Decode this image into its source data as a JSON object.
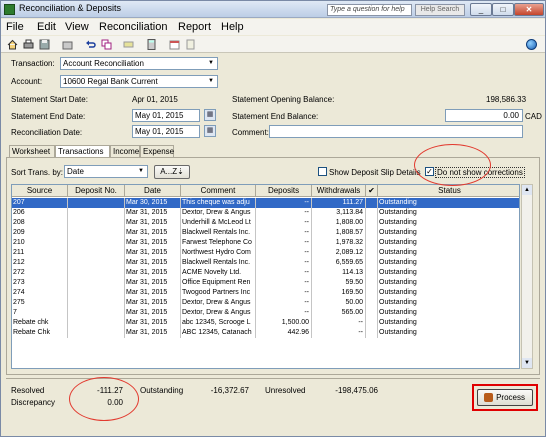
{
  "window": {
    "title": "Reconciliation & Deposits",
    "help_placeholder": "Type a question for help",
    "help_search": "Help Search",
    "min": "_",
    "max": "□",
    "close": "✕"
  },
  "menu": [
    "File",
    "Edit",
    "View",
    "Reconciliation",
    "Report",
    "Help"
  ],
  "toolbar_icons": [
    "home-icon",
    "print-icon",
    "save-icon",
    "open-icon",
    "undo-icon",
    "copy-icon",
    "highlight-icon",
    "calculator-icon",
    "calendar-icon",
    "notes-icon"
  ],
  "form": {
    "transaction_label": "Transaction:",
    "transaction_value": "Account Reconciliation",
    "account_label": "Account:",
    "account_value": "10600 Regal Bank Current",
    "start_date_label": "Statement Start Date:",
    "start_date_value": "Apr 01, 2015",
    "end_date_label": "Statement End Date:",
    "end_date_value": "May 01, 2015",
    "recon_date_label": "Reconciliation Date:",
    "recon_date_value": "May 01, 2015",
    "opening_balance_label": "Statement Opening Balance:",
    "opening_balance_value": "198,586.33",
    "end_balance_label": "Statement End Balance:",
    "end_balance_value": "0.00",
    "currency": "CAD",
    "comment_label": "Comment:",
    "comment_value": ""
  },
  "tabs": [
    "Worksheet",
    "Transactions",
    "Income",
    "Expense"
  ],
  "active_tab": 1,
  "sort": {
    "label": "Sort Trans. by:",
    "value": "Date",
    "az_button": "A...Z",
    "show_deposit_slip_label": "Show Deposit Slip Details",
    "show_deposit_slip_checked": false,
    "no_corrections_label": "Do not show corrections",
    "no_corrections_checked": true
  },
  "table": {
    "columns": [
      "Source",
      "Deposit No.",
      "Date",
      "Comment",
      "Deposits",
      "Withdrawals",
      "✔",
      "Status"
    ],
    "rows": [
      [
        "207",
        "",
        "Mar 30, 2015",
        "This cheque was adju",
        "--",
        "111.27",
        "",
        "Outstanding"
      ],
      [
        "206",
        "",
        "Mar 31, 2015",
        "Dextor, Drew & Angus",
        "--",
        "3,113.84",
        "",
        "Outstanding"
      ],
      [
        "208",
        "",
        "Mar 31, 2015",
        "Underhill & McLeod Lt",
        "--",
        "1,808.00",
        "",
        "Outstanding"
      ],
      [
        "209",
        "",
        "Mar 31, 2015",
        "Blackwell Rentals Inc.",
        "--",
        "1,808.57",
        "",
        "Outstanding"
      ],
      [
        "210",
        "",
        "Mar 31, 2015",
        "Farwest Telephone Co",
        "--",
        "1,978.32",
        "",
        "Outstanding"
      ],
      [
        "211",
        "",
        "Mar 31, 2015",
        "Northwest Hydro Com",
        "--",
        "2,089.12",
        "",
        "Outstanding"
      ],
      [
        "212",
        "",
        "Mar 31, 2015",
        "Blackwell Rentals Inc.",
        "--",
        "6,559.65",
        "",
        "Outstanding"
      ],
      [
        "272",
        "",
        "Mar 31, 2015",
        "ACME Novelty Ltd.",
        "--",
        "114.13",
        "",
        "Outstanding"
      ],
      [
        "273",
        "",
        "Mar 31, 2015",
        "Office Equipment Ren",
        "--",
        "59.50",
        "",
        "Outstanding"
      ],
      [
        "274",
        "",
        "Mar 31, 2015",
        "Twogood Partners Inc",
        "--",
        "169.50",
        "",
        "Outstanding"
      ],
      [
        "275",
        "",
        "Mar 31, 2015",
        "Dextor, Drew & Angus",
        "--",
        "50.00",
        "",
        "Outstanding"
      ],
      [
        "7",
        "",
        "Mar 31, 2015",
        "Dextor, Drew & Angus",
        "--",
        "565.00",
        "",
        "Outstanding"
      ],
      [
        "Rebate chk",
        "",
        "Mar 31, 2015",
        "abc 12345, Scrooge L",
        "1,500.00",
        "--",
        "",
        "Outstanding"
      ],
      [
        "Rebate Chk",
        "",
        "Mar 31, 2015",
        "ABC 12345, Catanach",
        "442.96",
        "--",
        "",
        "Outstanding"
      ]
    ],
    "selected_row": 0
  },
  "footer": {
    "resolved_label": "Resolved",
    "resolved_value": "-111.27",
    "discrepancy_label": "Discrepancy",
    "discrepancy_value": "0.00",
    "outstanding_label": "Outstanding",
    "outstanding_value": "-16,372.67",
    "unresolved_label": "Unresolved",
    "unresolved_value": "-198,475.06",
    "process_button": "Process"
  },
  "colors": {
    "selection": "#3169c6",
    "annotation_red": "#e00000"
  }
}
